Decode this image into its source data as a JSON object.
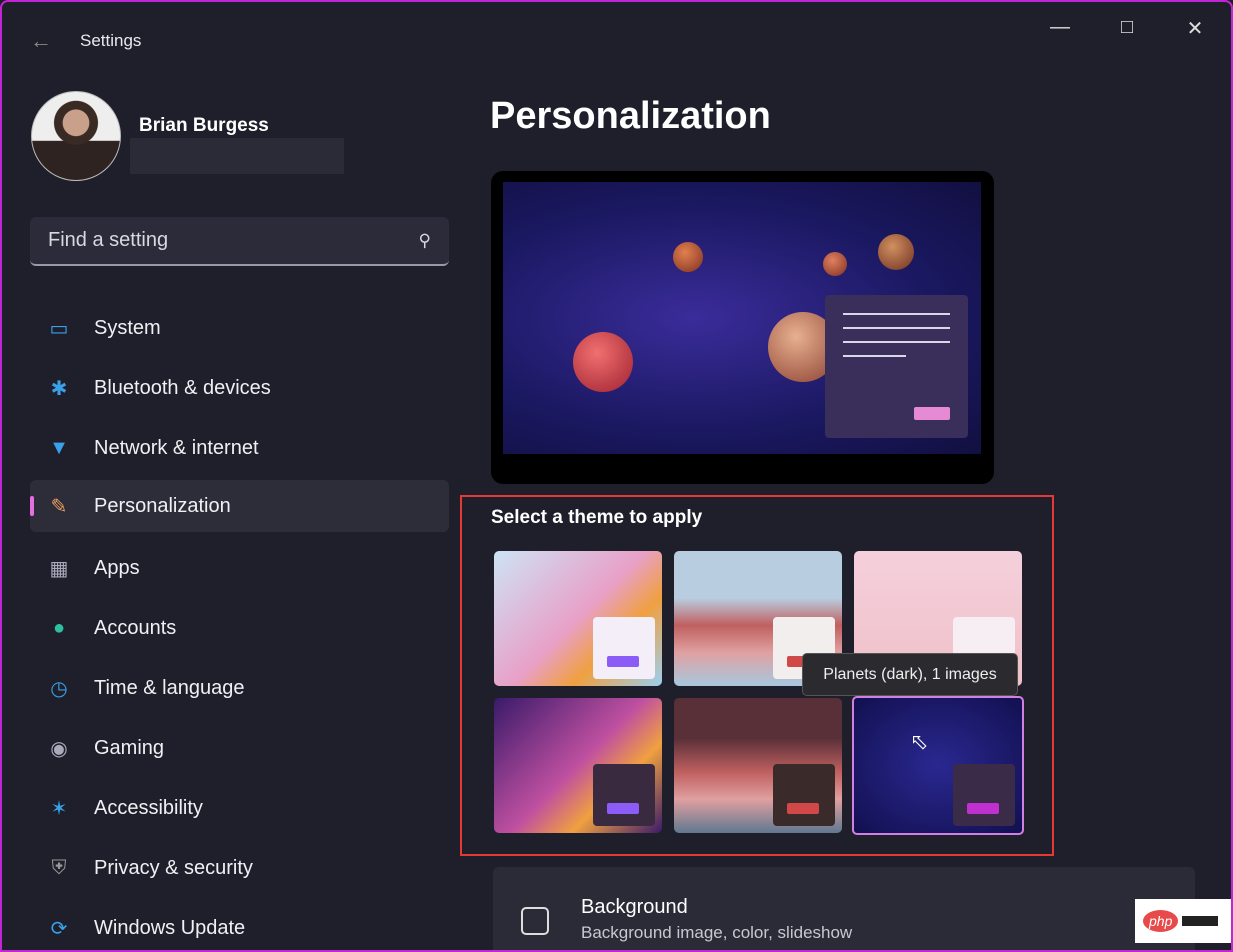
{
  "window": {
    "title": "Settings",
    "controls": [
      "minimize",
      "maximize",
      "close"
    ]
  },
  "user": {
    "name": "Brian Burgess"
  },
  "search": {
    "placeholder": "Find a setting"
  },
  "sidebar": {
    "items": [
      {
        "label": "System",
        "icon": "monitor-icon"
      },
      {
        "label": "Bluetooth & devices",
        "icon": "bluetooth-icon"
      },
      {
        "label": "Network & internet",
        "icon": "wifi-icon"
      },
      {
        "label": "Personalization",
        "icon": "brush-icon",
        "selected": true
      },
      {
        "label": "Apps",
        "icon": "apps-icon"
      },
      {
        "label": "Accounts",
        "icon": "person-icon"
      },
      {
        "label": "Time & language",
        "icon": "clock-globe-icon"
      },
      {
        "label": "Gaming",
        "icon": "gamepad-icon"
      },
      {
        "label": "Accessibility",
        "icon": "accessibility-icon"
      },
      {
        "label": "Privacy & security",
        "icon": "shield-icon"
      },
      {
        "label": "Windows Update",
        "icon": "update-icon"
      }
    ]
  },
  "main": {
    "title": "Personalization",
    "themes_label": "Select a theme to apply",
    "tooltip": "Planets (dark), 1 images",
    "background": {
      "title": "Background",
      "subtitle": "Background image, color, slideshow"
    }
  },
  "colors": {
    "accent": "#e56fe0",
    "highlight_border": "#e53935",
    "window_border": "#c026d3"
  },
  "watermark": "php"
}
